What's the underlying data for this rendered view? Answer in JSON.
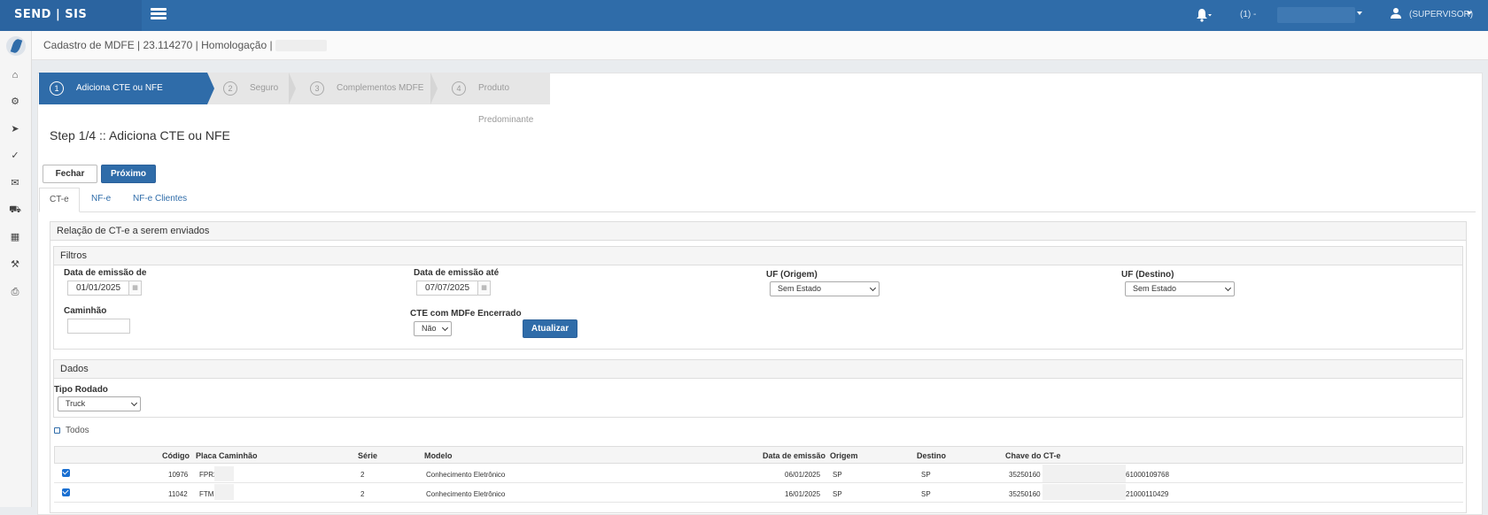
{
  "topbar": {
    "brand": "SEND | SIS",
    "company_label": "(1) -",
    "user_label": "(SUPERVISOR)"
  },
  "page": {
    "breadcrumb": "Cadastro de MDFE | 23.114270 | Homologação |"
  },
  "wizard": {
    "steps": [
      {
        "num": "1",
        "label": "Adiciona CTE ou NFE"
      },
      {
        "num": "2",
        "label": "Seguro"
      },
      {
        "num": "3",
        "label": "Complementos MDFE"
      },
      {
        "num": "4",
        "label": "Produto Predominante"
      }
    ],
    "active_step": 1,
    "title": "Step 1/4 :: Adiciona CTE ou NFE"
  },
  "buttons": {
    "close": "Fechar",
    "next": "Próximo",
    "refresh": "Atualizar"
  },
  "tabs": [
    "CT-e",
    "NF-e",
    "NF-e Clientes"
  ],
  "relation_panel": {
    "title": "Relação de CT-e a serem enviados"
  },
  "filters": {
    "title": "Filtros",
    "date_from_label": "Data de emissão de",
    "date_from": "01/01/2025",
    "date_to_label": "Data de emissão até",
    "date_to": "07/07/2025",
    "uf_origin_label": "UF (Origem)",
    "uf_origin": "Sem Estado",
    "uf_dest_label": "UF (Destino)",
    "uf_dest": "Sem Estado",
    "truck_label": "Caminhão",
    "truck_value": "",
    "closed_label": "CTE com MDFe Encerrado",
    "closed_value": "Não"
  },
  "dados": {
    "title": "Dados",
    "tipo_label": "Tipo Rodado",
    "tipo_value": "Truck"
  },
  "select_all": {
    "label": "Todos",
    "checked": false
  },
  "table": {
    "headers": [
      "Código",
      "Placa Caminhão",
      "Série",
      "Modelo",
      "Data de emissão",
      "Origem",
      "Destino",
      "Chave do CT-e"
    ],
    "rows": [
      {
        "checked": true,
        "codigo": "10976",
        "placa": "FPR2",
        "serie": "2",
        "modelo": "Conhecimento Eletrônico",
        "data": "06/01/2025",
        "origem": "SP",
        "destino": "SP",
        "chave_start": "35250160",
        "chave_end": "61000109768"
      },
      {
        "checked": true,
        "codigo": "11042",
        "placa": "FTM3",
        "serie": "2",
        "modelo": "Conhecimento Eletrônico",
        "data": "16/01/2025",
        "origem": "SP",
        "destino": "SP",
        "chave_start": "35250160",
        "chave_end": "21000110429"
      }
    ]
  },
  "colors": {
    "primary": "#2f6ca9",
    "topbar": "#2f6ca9",
    "checkbox": "#1a6fd1"
  }
}
